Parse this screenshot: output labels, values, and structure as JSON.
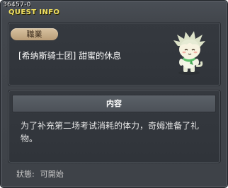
{
  "window": {
    "quest_id": "36457-0",
    "title": "QUEST INFO"
  },
  "quest": {
    "category_tag": "職業",
    "name": "[希纳斯骑士团] 甜蜜的休息",
    "npc_icon": "white-hair-child-npc"
  },
  "content": {
    "header": "内容",
    "description": "为了补充第二场考试消耗的体力，奇姆准备了礼物。"
  },
  "status": {
    "label": "狀態:",
    "value": "可開始"
  }
}
